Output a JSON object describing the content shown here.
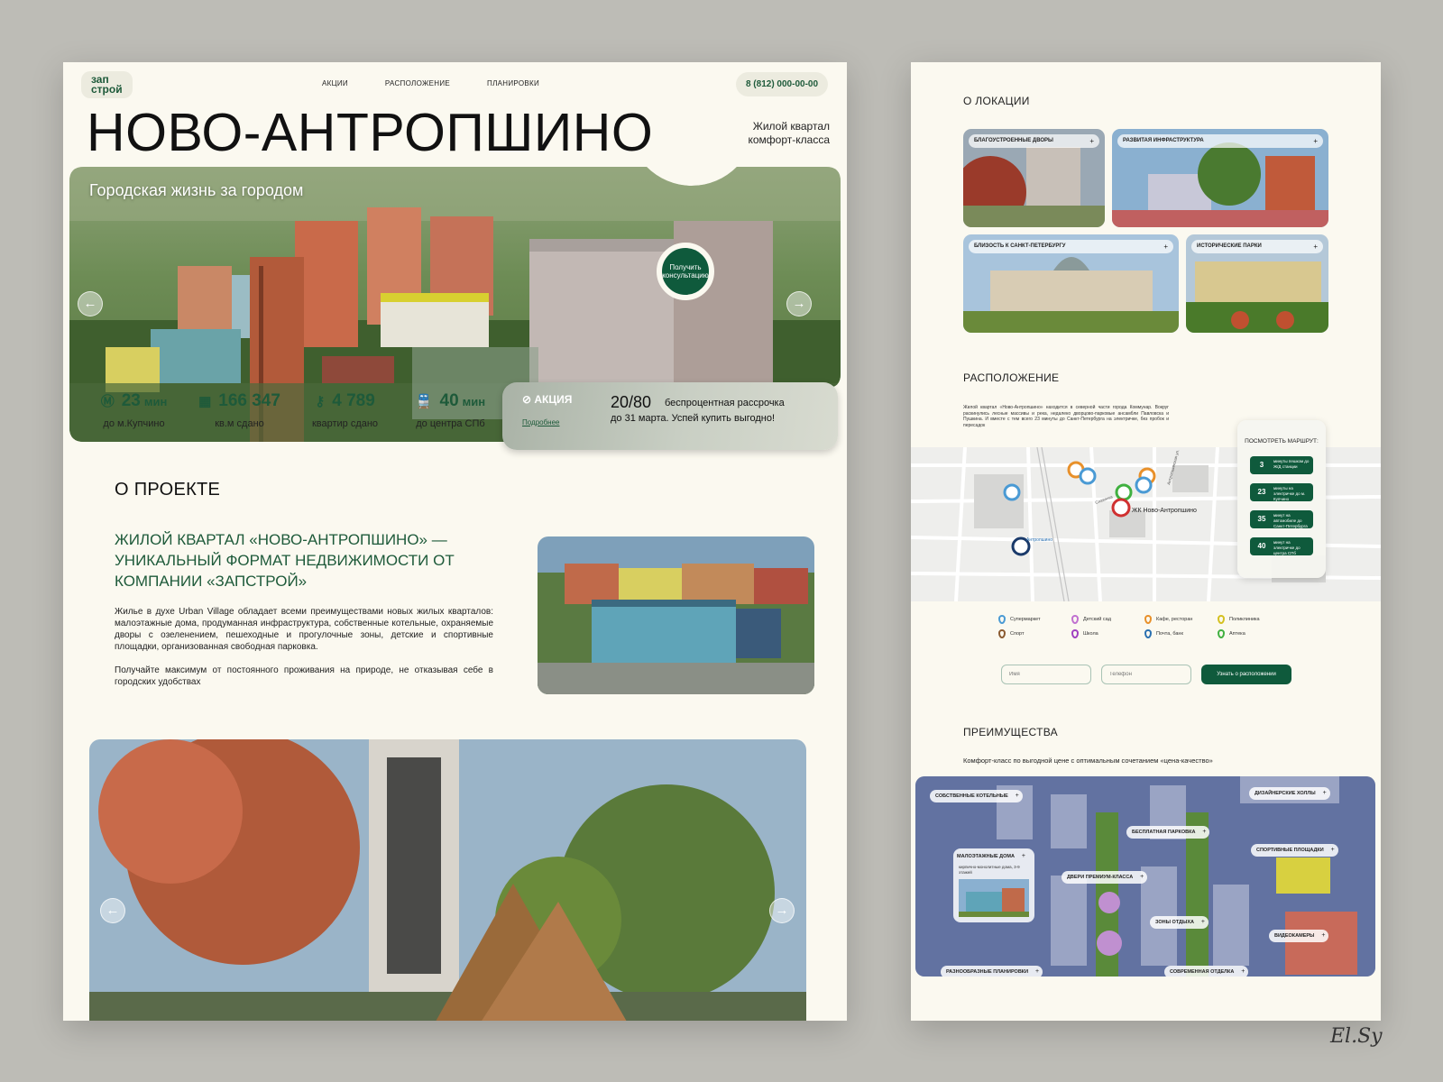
{
  "colors": {
    "brand_green": "#0f5a3c",
    "page_bg": "#fbf9f0",
    "backdrop": "#bdbcb6"
  },
  "header": {
    "logo_line1": "зап",
    "logo_line2": "строй",
    "nav": [
      "АКЦИИ",
      "РАСПОЛОЖЕНИЕ",
      "ПЛАНИРОВКИ"
    ],
    "phone": "8 (812) 000-00-00"
  },
  "hero": {
    "title": "НОВО-АНТРОПШИНО",
    "subtitle": "Жилой квартал комфорт-класса",
    "caption": "Городская жизнь за городом",
    "consult_button": "Получить консультацию",
    "prev_icon": "arrow-left-icon",
    "next_icon": "arrow-right-icon"
  },
  "stats": [
    {
      "icon": "metro-icon",
      "value": "23",
      "unit": "мин",
      "label": "до м.Купчино"
    },
    {
      "icon": "building-icon",
      "value": "166 347",
      "unit": "",
      "label": "кв.м сдано"
    },
    {
      "icon": "keys-icon",
      "value": "4 789",
      "unit": "",
      "label": "квартир сдано"
    },
    {
      "icon": "train-icon",
      "value": "40",
      "unit": "мин",
      "label": "до центра СПб"
    }
  ],
  "promo": {
    "tag": "АКЦИЯ",
    "more": "Подробнее",
    "big": "20/80",
    "text1": "беспроцентная рассрочка",
    "text2": "до 31 марта.  Успей купить выгодно!"
  },
  "about": {
    "title": "О ПРОЕКТЕ",
    "heading": "ЖИЛОЙ КВАРТАЛ «НОВО-АНТРОПШИНО» — УНИКАЛЬНЫЙ ФОРМАТ НЕДВИЖИМОСТИ ОТ КОМПАНИИ «ЗАПСТРОЙ»",
    "p1": "Жилье в духе Urban Village обладает всеми преимуществами новых жилых кварталов: малоэтажные дома, продуманная инфраструктура, собственные котельные, охраняемые дворы с озеленением, пешеходные и прогулочные зоны, детские и спортивные площадки, организованная свободная парковка.",
    "p2": "Получайте максимум от постоянного проживания на природе, не отказывая себе в городских удобствах"
  },
  "location": {
    "title": "О ЛОКАЦИИ",
    "cards": [
      "БЛАГОУСТРОЕННЫЕ ДВОРЫ",
      "РАЗВИТАЯ ИНФРАСТРУКТУРА",
      "БЛИЗОСТЬ К САНКТ-ПЕТЕРБУРГУ",
      "ИСТОРИЧЕСКИЕ ПАРКИ"
    ]
  },
  "placement": {
    "title": "РАСПОЛОЖЕНИЕ",
    "text": "Жилой квартал «Ново-Антропшино» находится в северной части города Коммунар. Вокруг раскинулись лесные массивы и река, недалеко дворцово-парковые ансамбли Павловска и Пушкина. И вместе с тем всего 23 минуты до Санкт-Петербурга на электричке, без пробок и пересадок",
    "map_label": "ЖК Ново-Антропшино",
    "map_station": "Антропшино",
    "map_street1": "Славянка",
    "map_street2": "Антропшинская ул.",
    "route_title": "ПОСМОТРЕТЬ МАРШРУТ:",
    "routes": [
      {
        "n": "3",
        "d": "минуты пешком до Ж/Д станции"
      },
      {
        "n": "23",
        "d": "минуты на электричке до м. Купчино"
      },
      {
        "n": "35",
        "d": "минут на автомобиле до Санкт-Петербурга"
      },
      {
        "n": "40",
        "d": "минут на электричке до центра СПб"
      }
    ],
    "legend": [
      {
        "label": "Супермаркет",
        "color": "#4a9ad4"
      },
      {
        "label": "Детский сад",
        "color": "#c070d0"
      },
      {
        "label": "Кафе, ресторан",
        "color": "#e8902a"
      },
      {
        "label": "Поликлиника",
        "color": "#d4c020"
      },
      {
        "label": "Спорт",
        "color": "#8a5a30"
      },
      {
        "label": "Школа",
        "color": "#a040c0"
      },
      {
        "label": "Почта, банк",
        "color": "#2a70b0"
      },
      {
        "label": "Аптека",
        "color": "#40b040"
      }
    ],
    "name_placeholder": "Имя",
    "phone_placeholder": "Телефон",
    "submit": "Узнать о расположении"
  },
  "advantages": {
    "title": "ПРЕИМУЩЕСТВА",
    "subtitle": "Комфорт-класс по выгодной цене с оптимальным сочетанием «цена-качество»",
    "labels": [
      "СОБСТВЕННЫЕ КОТЕЛЬНЫЕ",
      "ДИЗАЙНЕРСКИЕ ХОЛЛЫ",
      "БЕСПЛАТНАЯ ПАРКОВКА",
      "СПОРТИВНЫЕ ПЛОЩАДКИ",
      "МАЛОЭТАЖНЫЕ ДОМА",
      "ДВЕРИ ПРЕМИУМ-КЛАССА",
      "ЗОНЫ ОТДЫХА",
      "ВИДЕОКАМЕРЫ",
      "РАЗНООБРАЗНЫЕ ПЛАНИРОВКИ",
      "СОВРЕМЕННАЯ ОТДЕЛКА"
    ],
    "lowrise_desc": "кирпично-монолитные дома, 3-9 этажей"
  },
  "signature": "El.Sy"
}
